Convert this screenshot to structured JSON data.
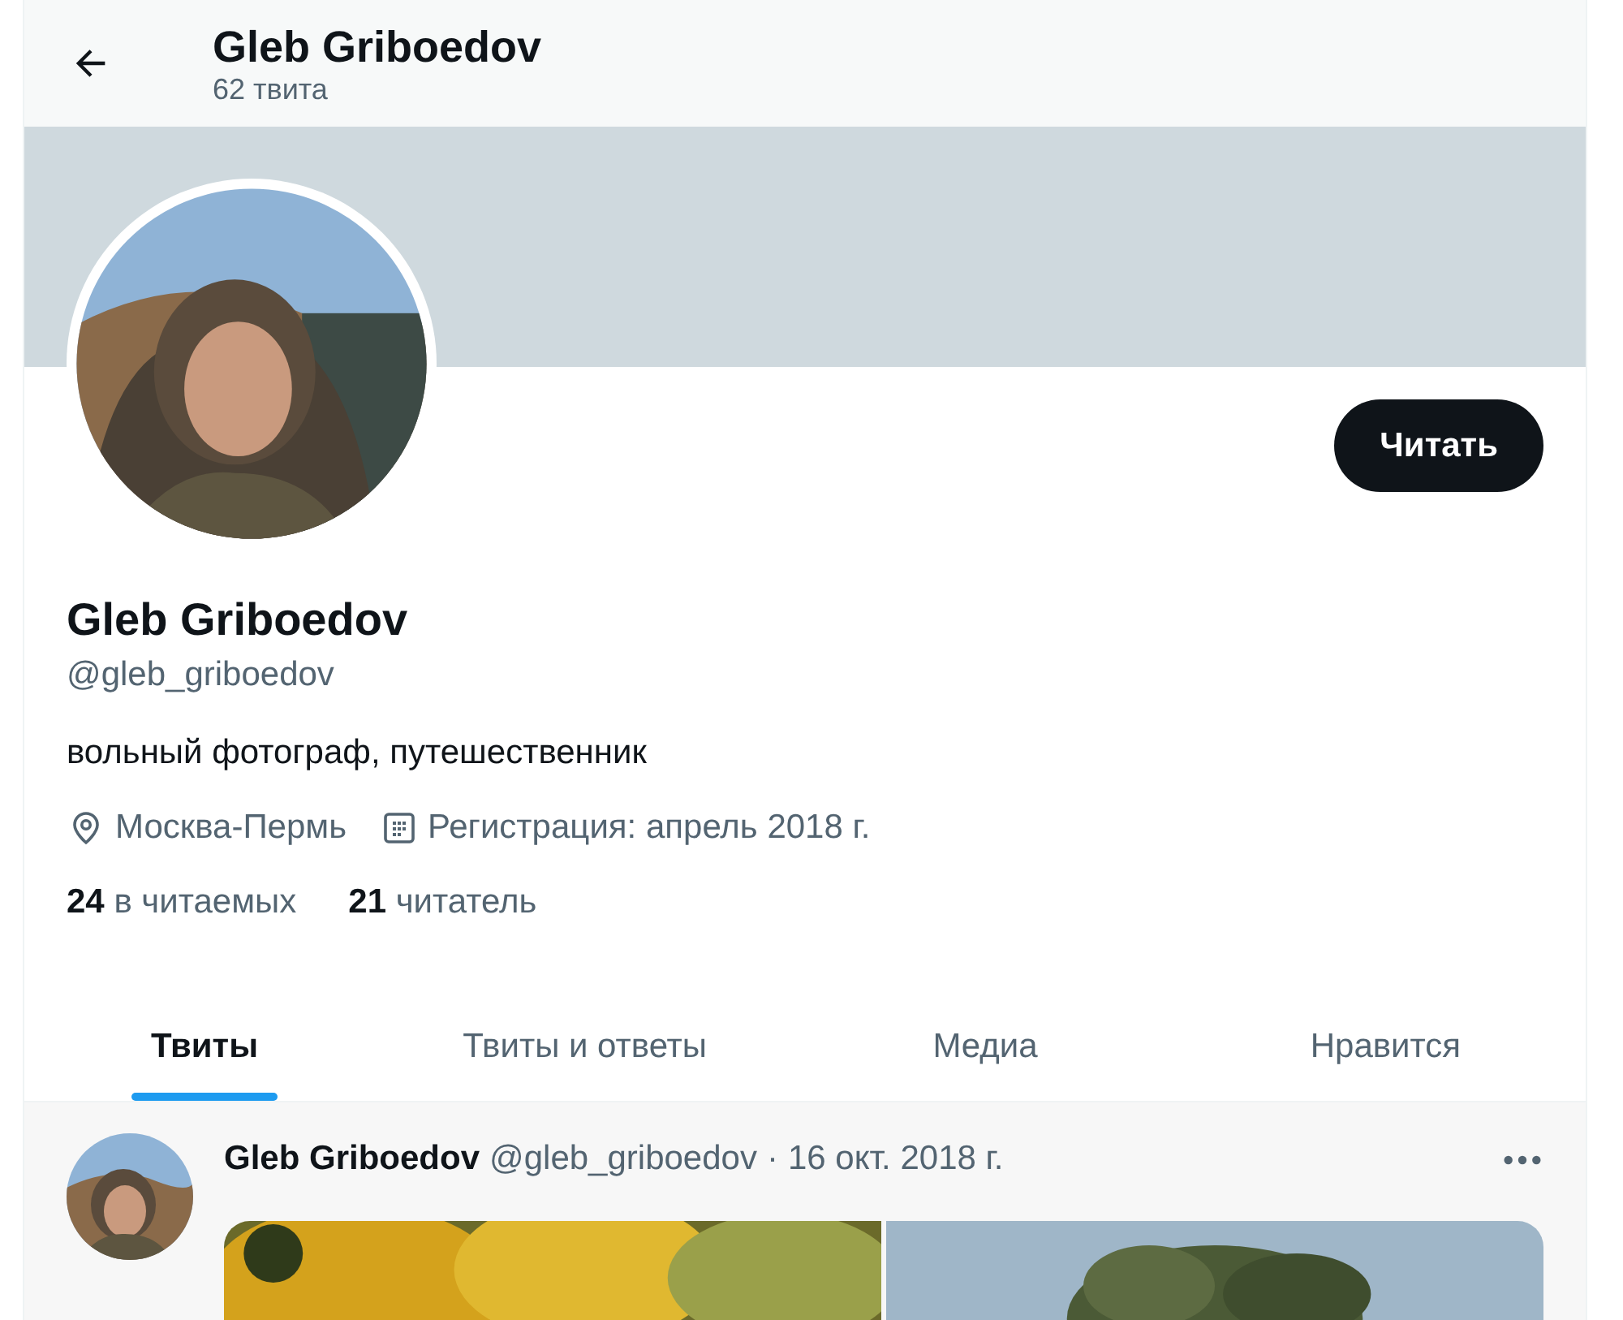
{
  "header": {
    "title": "Gleb Griboedov",
    "subtitle": "62 твита"
  },
  "profile": {
    "name": "Gleb Griboedov",
    "handle": "@gleb_griboedov",
    "bio": "вольный фотограф, путешественник",
    "location": "Москва-Пермь",
    "joined": "Регистрация: апрель 2018 г.",
    "follow_button": "Читать",
    "stats": [
      {
        "count": "24",
        "label": "в читаемых"
      },
      {
        "count": "21",
        "label": "читатель"
      }
    ]
  },
  "tabs": [
    {
      "label": "Твиты",
      "selected": true
    },
    {
      "label": "Твиты и ответы",
      "selected": false
    },
    {
      "label": "Медиа",
      "selected": false
    },
    {
      "label": "Нравится",
      "selected": false
    }
  ],
  "tweet": {
    "author": "Gleb Griboedov",
    "handle": "@gleb_griboedov",
    "separator": "·",
    "date": "16 окт. 2018 г."
  }
}
